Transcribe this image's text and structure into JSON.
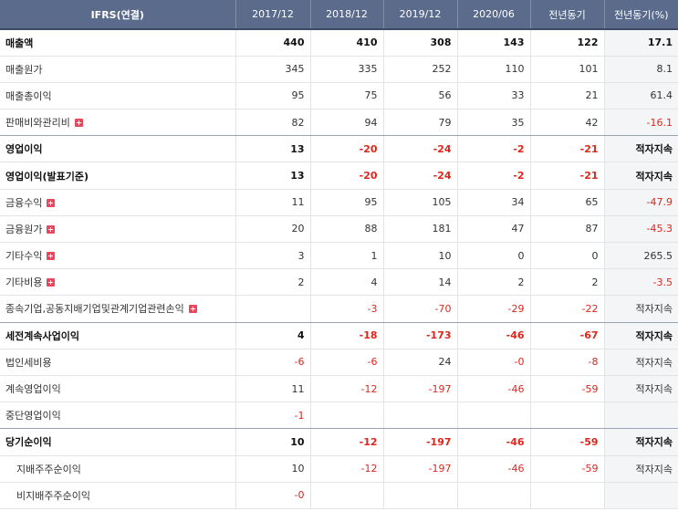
{
  "header": {
    "title": "IFRS(연결)",
    "columns": [
      "2017/12",
      "2018/12",
      "2019/12",
      "2020/06",
      "전년동기",
      "전년동기(%)"
    ]
  },
  "rows": [
    {
      "label": "매출액",
      "values": [
        "440",
        "410",
        "308",
        "143",
        "122",
        "17.1"
      ]
    },
    {
      "label": "매출원가",
      "values": [
        "345",
        "335",
        "252",
        "110",
        "101",
        "8.1"
      ]
    },
    {
      "label": "매출총이익",
      "values": [
        "95",
        "75",
        "56",
        "33",
        "21",
        "61.4"
      ]
    },
    {
      "label": "판매비와관리비",
      "values": [
        "82",
        "94",
        "79",
        "35",
        "42",
        "-16.1"
      ]
    },
    {
      "label": "영업이익",
      "values": [
        "13",
        "-20",
        "-24",
        "-2",
        "-21",
        "적자지속"
      ]
    },
    {
      "label": "영업이익(발표기준)",
      "values": [
        "13",
        "-20",
        "-24",
        "-2",
        "-21",
        "적자지속"
      ]
    },
    {
      "label": "금융수익",
      "values": [
        "11",
        "95",
        "105",
        "34",
        "65",
        "-47.9"
      ]
    },
    {
      "label": "금융원가",
      "values": [
        "20",
        "88",
        "181",
        "47",
        "87",
        "-45.3"
      ]
    },
    {
      "label": "기타수익",
      "values": [
        "3",
        "1",
        "10",
        "0",
        "0",
        "265.5"
      ]
    },
    {
      "label": "기타비용",
      "values": [
        "2",
        "4",
        "14",
        "2",
        "2",
        "-3.5"
      ]
    },
    {
      "label": "종속기업,공동지배기업및관계기업관련손익",
      "values": [
        "",
        "-3",
        "-70",
        "-29",
        "-22",
        "적자지속"
      ]
    },
    {
      "label": "세전계속사업이익",
      "values": [
        "4",
        "-18",
        "-173",
        "-46",
        "-67",
        "적자지속"
      ]
    },
    {
      "label": "법인세비용",
      "values": [
        "-6",
        "-6",
        "24",
        "-0",
        "-8",
        "적자지속"
      ]
    },
    {
      "label": "계속영업이익",
      "values": [
        "11",
        "-12",
        "-197",
        "-46",
        "-59",
        "적자지속"
      ]
    },
    {
      "label": "중단영업이익",
      "values": [
        "-1",
        "",
        "",
        "",
        "",
        ""
      ]
    },
    {
      "label": "당기순이익",
      "values": [
        "10",
        "-12",
        "-197",
        "-46",
        "-59",
        "적자지속"
      ]
    },
    {
      "label": "지배주주순이익",
      "values": [
        "10",
        "-12",
        "-197",
        "-46",
        "-59",
        "적자지속"
      ]
    },
    {
      "label": "비지배주주순이익",
      "values": [
        "-0",
        "",
        "",
        "",
        "",
        ""
      ]
    }
  ],
  "colors": {
    "header_bg": "#5a6b8c",
    "negative": "#e0261c",
    "expand_icon": "#e8475d"
  }
}
